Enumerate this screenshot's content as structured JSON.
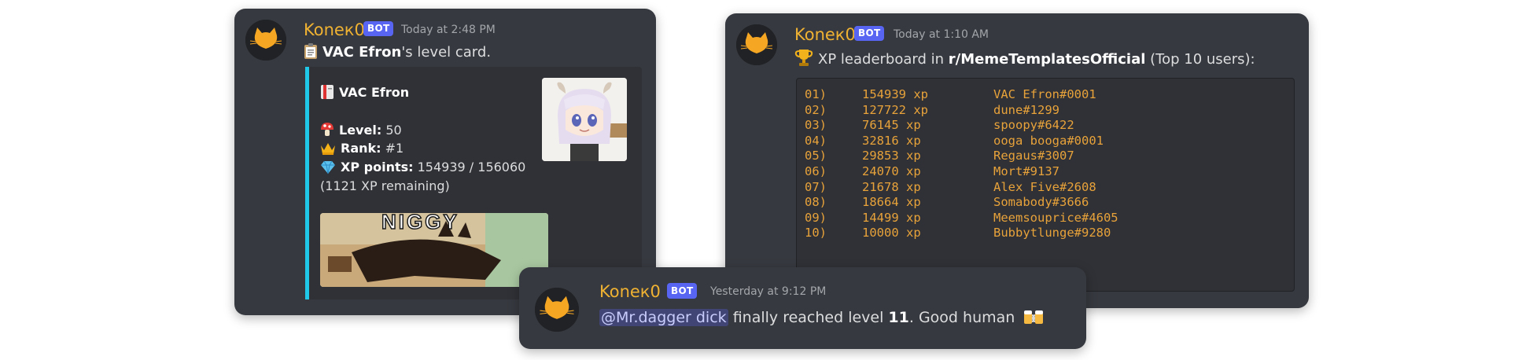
{
  "card_level": {
    "username": "Koneк0",
    "bot_badge": "BOT",
    "timestamp": "Today at 2:48 PM",
    "title_user": "VAC Efron",
    "title_suffix": "'s level card.",
    "embed": {
      "name": "VAC Efron",
      "level_label": "Level:",
      "level_value": "50",
      "rank_label": "Rank:",
      "rank_value": "#1",
      "xp_label": "XP points:",
      "xp_value": "154939 / 156060",
      "remaining": "(1121 XP remaining)",
      "image_caption": "NIGGY"
    },
    "colors": {
      "embed_bar": "#1fc7e8"
    }
  },
  "card_leaderboard": {
    "username": "Koneк0",
    "bot_badge": "BOT",
    "timestamp": "Today at 1:10 AM",
    "prefix": "XP leaderboard in ",
    "subreddit": "r/MemeTemplatesOfficial",
    "suffix": " (Top 10 users):",
    "rows": [
      {
        "rank": "01)",
        "xp": "154939 xp",
        "user": "VAC Efron#0001"
      },
      {
        "rank": "02)",
        "xp": "127722 xp",
        "user": "dune#1299"
      },
      {
        "rank": "03)",
        "xp": "76145 xp",
        "user": "spoopy#6422"
      },
      {
        "rank": "04)",
        "xp": "32816 xp",
        "user": "ooga booga#0001"
      },
      {
        "rank": "05)",
        "xp": "29853 xp",
        "user": "Regaus#3007"
      },
      {
        "rank": "06)",
        "xp": "24070 xp",
        "user": "Mort#9137"
      },
      {
        "rank": "07)",
        "xp": "21678 xp",
        "user": "Alex Five#2608"
      },
      {
        "rank": "08)",
        "xp": "18664 xp",
        "user": "Somabody#3666"
      },
      {
        "rank": "09)",
        "xp": "14499 xp",
        "user": "Meemsouprice#4605"
      },
      {
        "rank": "10)",
        "xp": "10000 xp",
        "user": "Bubbytlunge#9280"
      }
    ]
  },
  "card_levelup": {
    "username": "Koneк0",
    "bot_badge": "BOT",
    "timestamp": "Yesterday at 9:12 PM",
    "mention": "@Mr.dagger dick",
    "message_mid": " finally reached level ",
    "level": "11",
    "message_end": ". Good human"
  },
  "icons": {
    "avatar": "cat-face-icon",
    "clipboard": "clipboard-icon",
    "book": "bookmark-icon",
    "mushroom": "mushroom-icon",
    "crown": "crown-icon",
    "gem": "gem-icon",
    "trophy": "trophy-icon",
    "beers": "beer-mugs-icon"
  }
}
